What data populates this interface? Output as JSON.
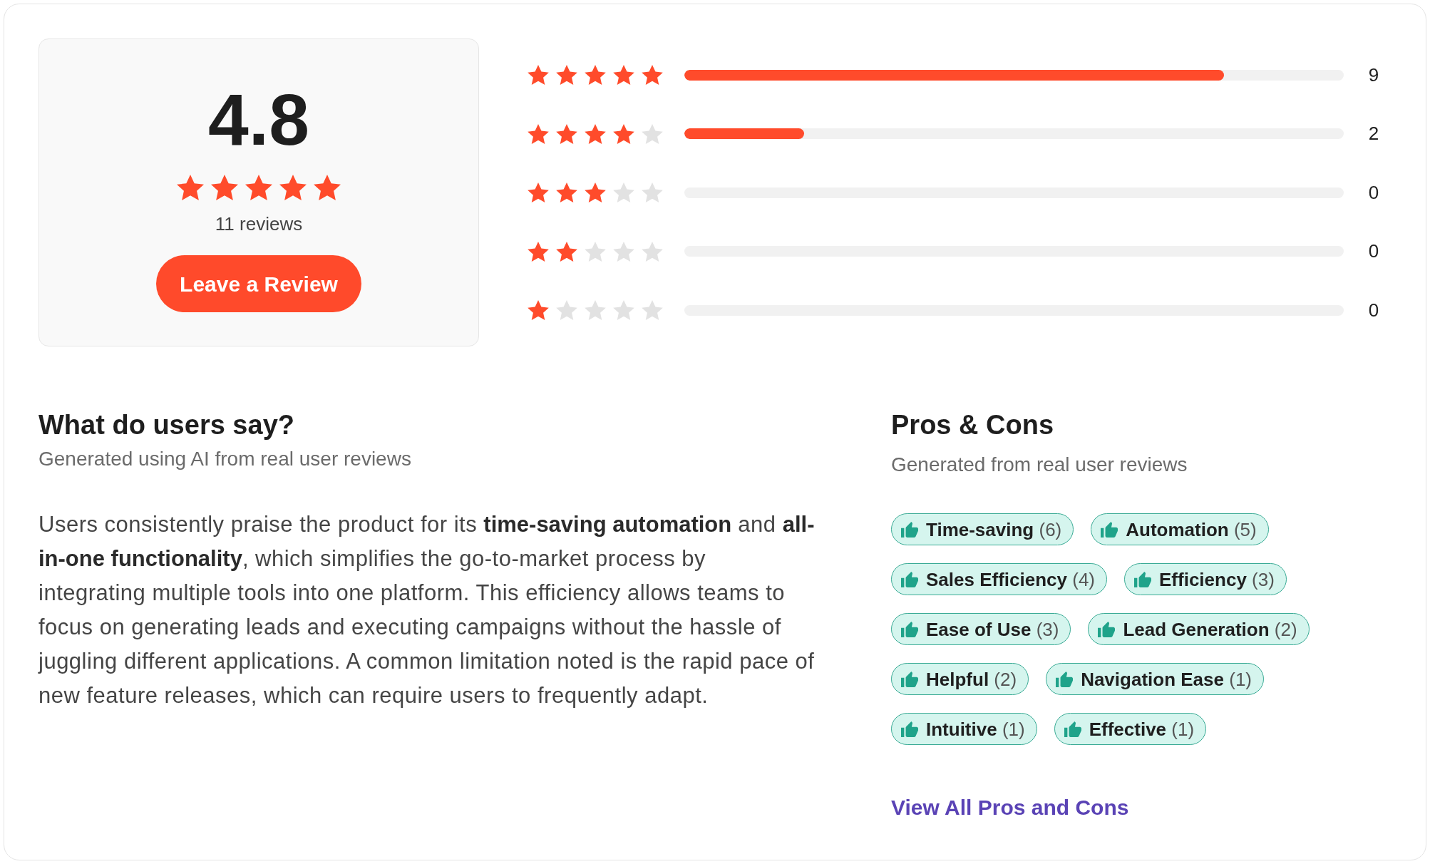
{
  "summary": {
    "rating": "4.8",
    "stars": 5,
    "review_count": "11 reviews",
    "button": "Leave a Review"
  },
  "distribution": [
    {
      "stars": 5,
      "level": 0.818,
      "count": "9"
    },
    {
      "stars": 4,
      "level": 0.182,
      "count": "2"
    },
    {
      "stars": 3,
      "count": "0"
    },
    {
      "stars": 2,
      "count": "0"
    },
    {
      "stars": 1,
      "count": "0"
    }
  ],
  "user_summary": {
    "title": "What do users say?",
    "subtitle": "Generated using AI from real user reviews",
    "text": "Users consistently praise the product for its **time-saving automation** and **all-in-one functionality**, which simplifies the go-to-market process by integrating multiple tools into one platform. This efficiency allows teams to focus on generating leads and executing campaigns without the hassle of juggling different applications. A common limitation noted is the rapid pace of new feature releases, which can require users to frequently adapt."
  },
  "pros_cons": {
    "title": "Pros & Cons",
    "subtitle": "Generated from real user reviews",
    "tags": [
      {
        "label": "Time-saving",
        "count": "(6)"
      },
      {
        "label": "Automation",
        "count": "(5)"
      },
      {
        "label": "Sales Efficiency",
        "count": "(4)"
      },
      {
        "label": "Efficiency",
        "count": "(3)"
      },
      {
        "label": "Ease of Use",
        "count": "(3)"
      },
      {
        "label": "Lead Generation",
        "count": "(2)"
      },
      {
        "label": "Helpful",
        "count": "(2)"
      },
      {
        "label": "Navigation Ease",
        "count": "(1)"
      },
      {
        "label": "Intuitive",
        "count": "(1)"
      },
      {
        "label": "Effective",
        "count": "(1)"
      }
    ],
    "link": "View All Pros and Cons"
  }
}
